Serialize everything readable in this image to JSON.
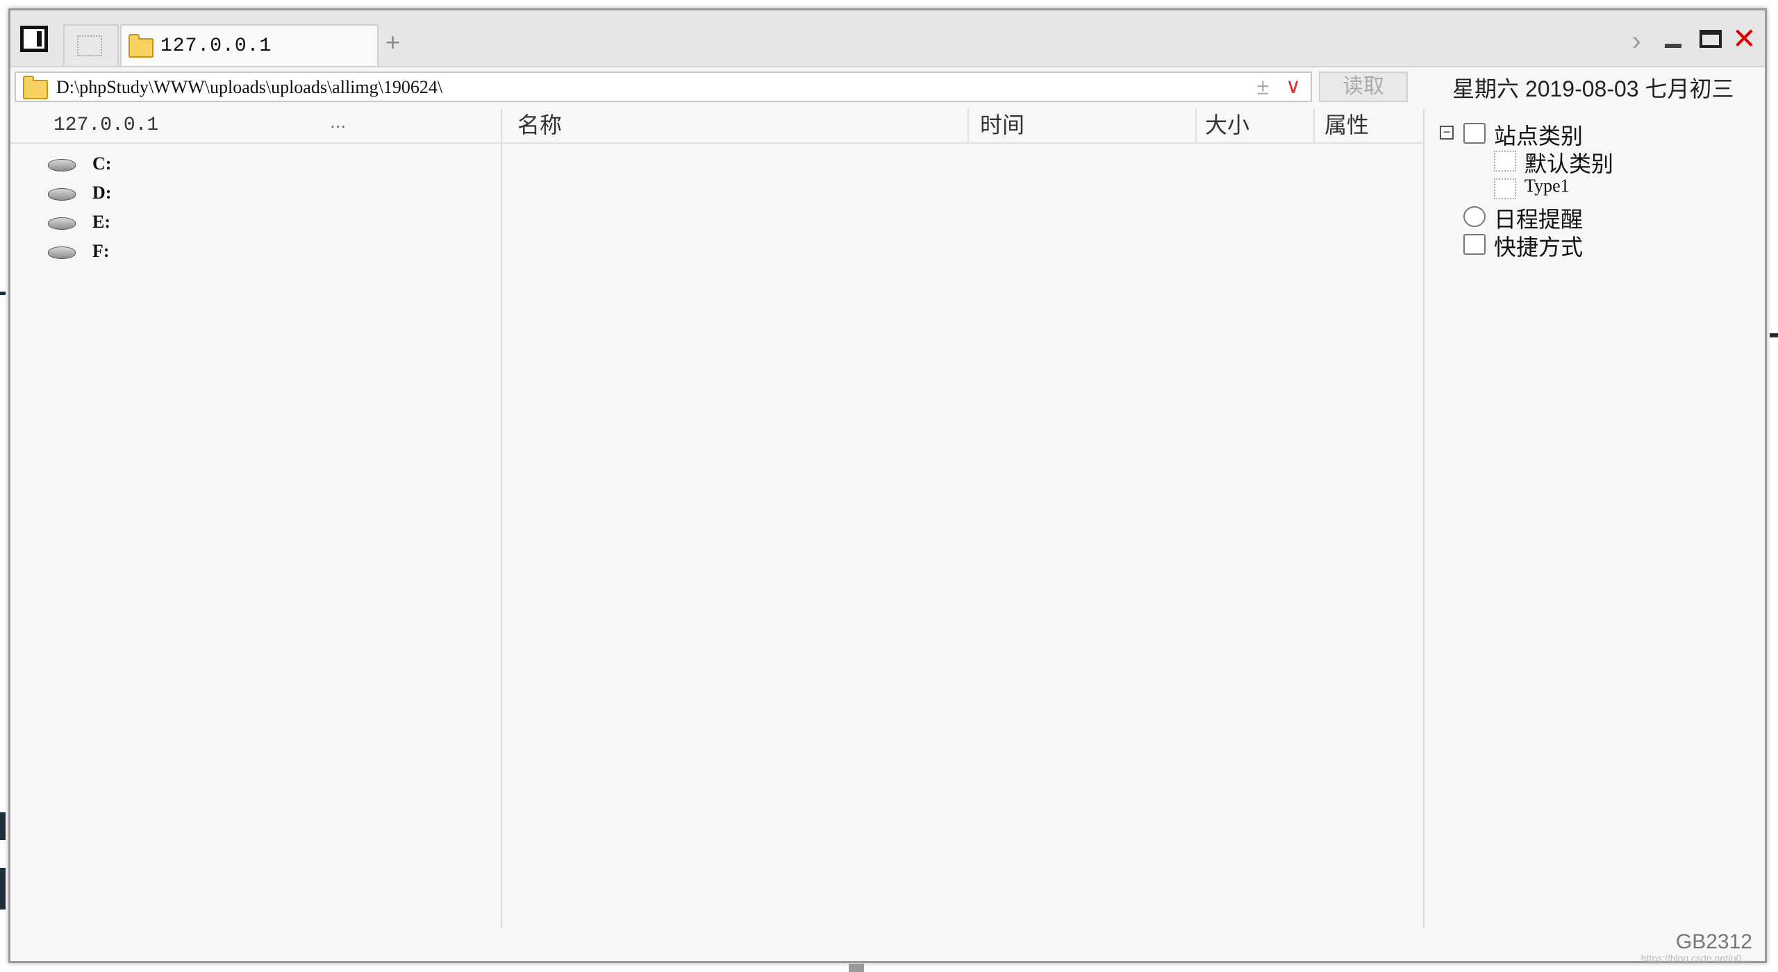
{
  "tabs": {
    "active_label": "127.0.0.1",
    "add_label": "+"
  },
  "window_controls": {
    "chevron": "›",
    "close": "✕"
  },
  "address": {
    "path": "D:\\phpStudy\\WWW\\uploads\\uploads\\allimg\\190624\\",
    "plusminus": "±",
    "dropdown": "∨",
    "read_button": "读取"
  },
  "date_display": "星期六 2019-08-03 七月初三",
  "left_pane": {
    "host": "127.0.0.1",
    "ellipsis": "...",
    "drives": [
      "C:",
      "D:",
      "E:",
      "F:"
    ]
  },
  "file_list": {
    "columns": [
      "名称",
      "时间",
      "大小",
      "属性"
    ]
  },
  "tree": {
    "collapse_symbol": "−",
    "root_label": "站点类别",
    "children": [
      "默认类别",
      "Type1"
    ],
    "schedule_label": "日程提醒",
    "shortcuts_label": "快捷方式"
  },
  "status": {
    "encoding": "GB2312",
    "watermark": "https://blog.csdn.net/u0...."
  },
  "icons": [
    "sidebar-toggle-icon",
    "folder-icon",
    "drive-icon",
    "tree-folder-icon",
    "clock-icon",
    "hand-icon",
    "close-icon",
    "maximize-icon",
    "minimize-icon",
    "chevron-right-icon"
  ]
}
